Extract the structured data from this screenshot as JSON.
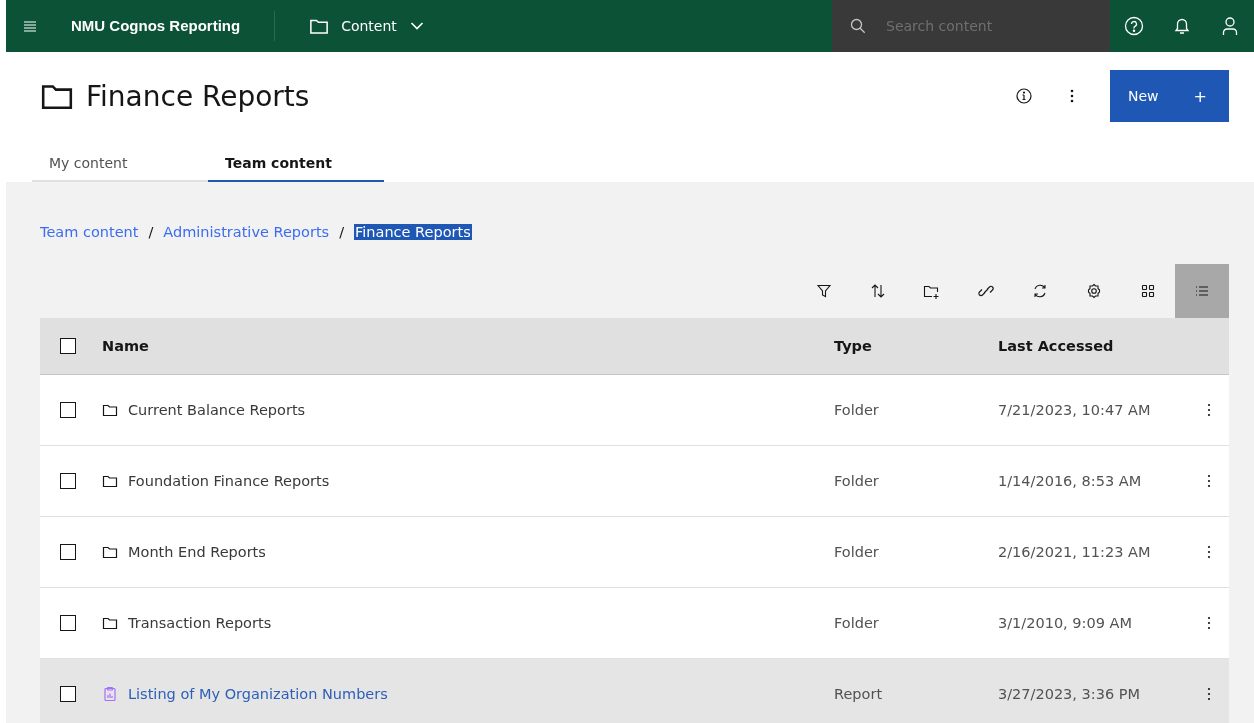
{
  "header": {
    "app_name": "NMU Cognos Reporting",
    "location": "Content",
    "search": {
      "placeholder": "Search content"
    }
  },
  "page": {
    "title": "Finance Reports",
    "new_button": "New",
    "new_button_icon": "+"
  },
  "tabs": [
    {
      "label": "My content",
      "selected": false
    },
    {
      "label": "Team content",
      "selected": true
    }
  ],
  "breadcrumb": [
    {
      "label": "Team content",
      "highlighted": false
    },
    {
      "label": "Administrative Reports",
      "highlighted": false
    },
    {
      "label": "Finance Reports",
      "highlighted": true
    }
  ],
  "breadcrumb_separator": "/",
  "toolbar": [
    {
      "kind": "filter",
      "selected": false
    },
    {
      "kind": "sort",
      "selected": false
    },
    {
      "kind": "new-folder",
      "selected": false
    },
    {
      "kind": "link",
      "selected": false
    },
    {
      "kind": "refresh",
      "selected": false
    },
    {
      "kind": "settings",
      "selected": false
    },
    {
      "kind": "grid",
      "selected": false
    },
    {
      "kind": "list",
      "selected": true
    }
  ],
  "table": {
    "columns": [
      "Name",
      "Type",
      "Last Accessed"
    ],
    "select_all_checked": false,
    "rows": [
      {
        "kind": "folder",
        "name": "Current Balance Reports",
        "type": "Folder",
        "last_accessed": "7/21/2023, 10:47 AM",
        "checked": false,
        "selected": false
      },
      {
        "kind": "folder",
        "name": "Foundation Finance Reports",
        "type": "Folder",
        "last_accessed": "1/14/2016, 8:53 AM",
        "checked": false,
        "selected": false
      },
      {
        "kind": "folder",
        "name": "Month End Reports",
        "type": "Folder",
        "last_accessed": "2/16/2021, 11:23 AM",
        "checked": false,
        "selected": false
      },
      {
        "kind": "folder",
        "name": "Transaction Reports",
        "type": "Folder",
        "last_accessed": "3/1/2010, 9:09 AM",
        "checked": false,
        "selected": false
      },
      {
        "kind": "report",
        "name": "Listing of My Organization Numbers",
        "type": "Report",
        "last_accessed": "3/27/2023, 3:36 PM",
        "checked": false,
        "selected": true
      }
    ]
  }
}
